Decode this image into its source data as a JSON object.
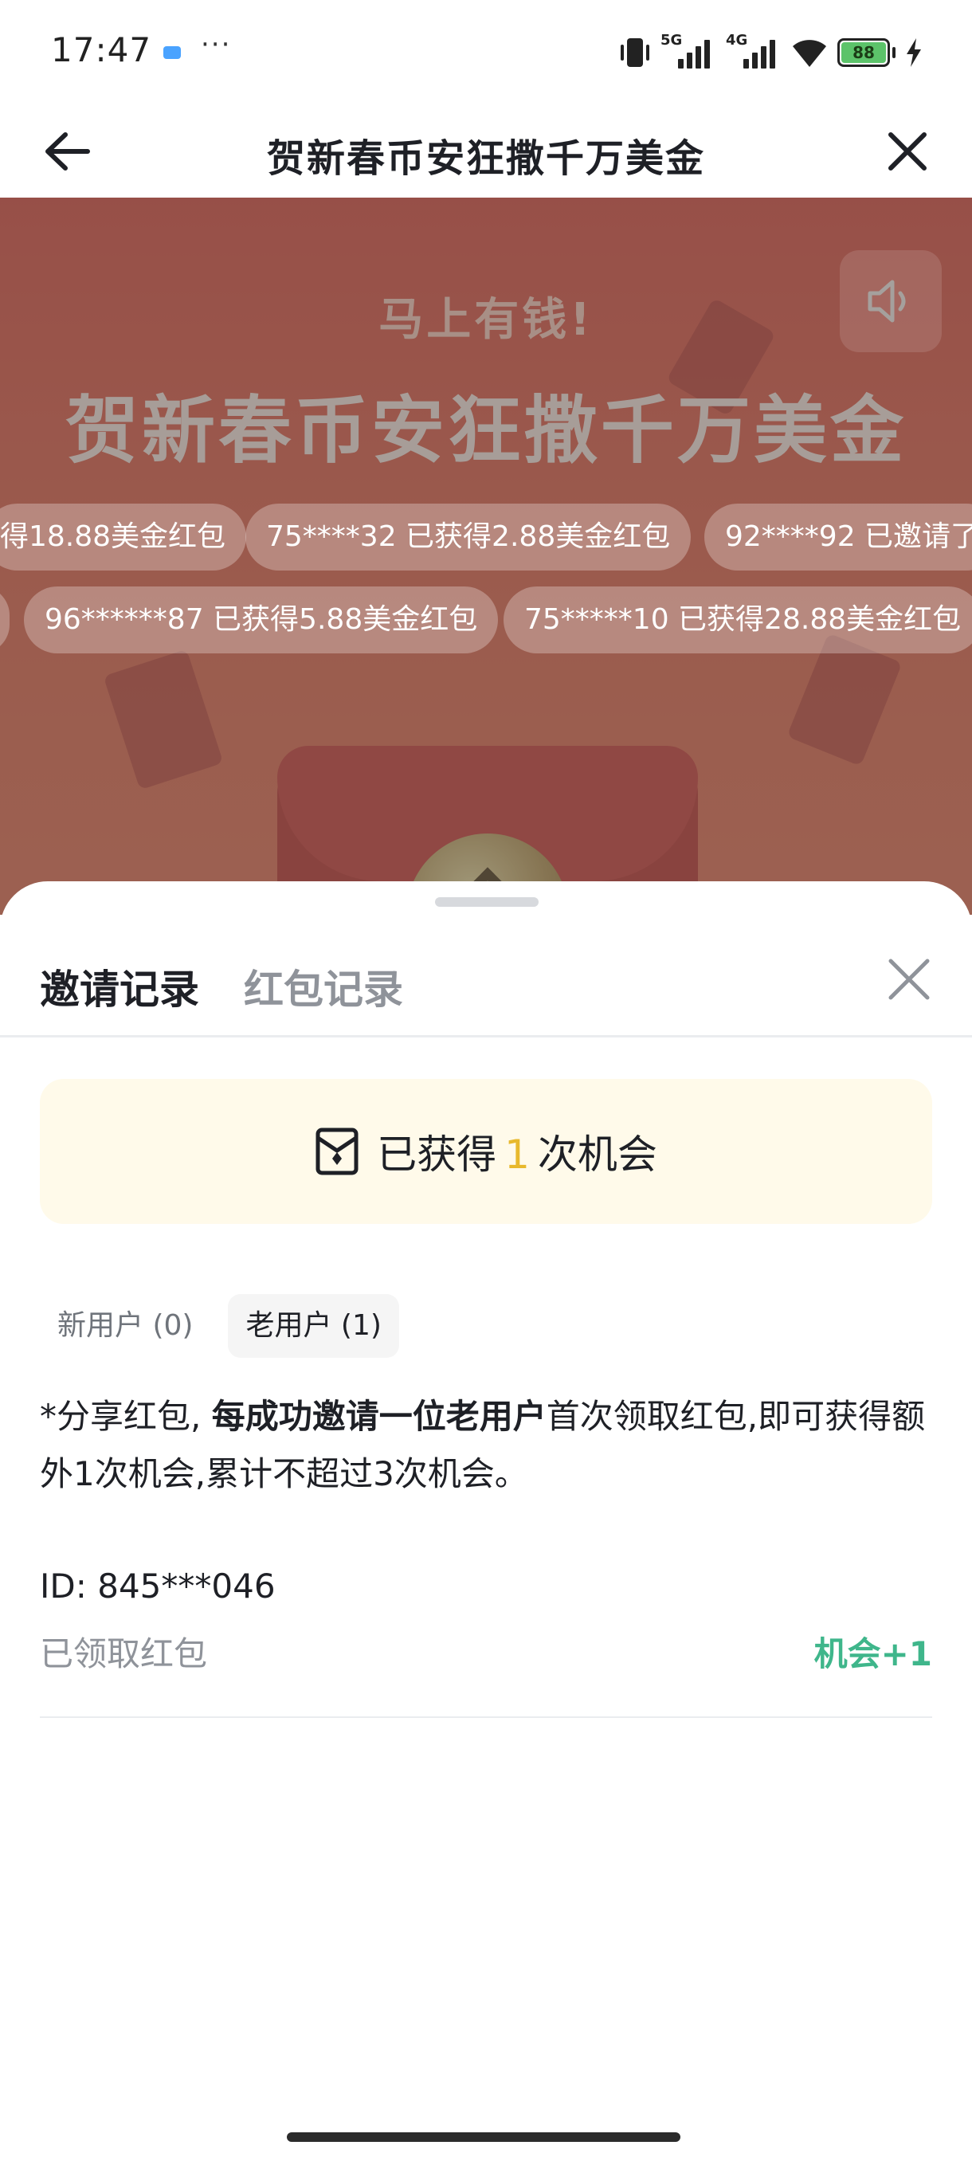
{
  "status_bar": {
    "time": "17:47",
    "more": "···",
    "network_5g": "5G",
    "network_4g": "4G",
    "battery": "88"
  },
  "header": {
    "title": "贺新春币安狂撒千万美金"
  },
  "banner": {
    "subtitle": "马上有钱!",
    "title": "贺新春币安狂撒千万美金",
    "ticker_row1": [
      "得18.88美金红包",
      "75****32 已获得2.88美金红包",
      "92****92 已邀请了"
    ],
    "ticker_row2": [
      "96******87 已获得5.88美金红包",
      "75*****10 已获得28.88美金红包"
    ]
  },
  "sheet": {
    "tabs": [
      {
        "label": "邀请记录",
        "active": true
      },
      {
        "label": "红包记录",
        "active": false
      }
    ],
    "chances": {
      "prefix": "已获得",
      "count": "1",
      "suffix": "次机会"
    },
    "filters": [
      {
        "label": "新用户 (0)",
        "selected": false
      },
      {
        "label": "老用户 (1)",
        "selected": true
      }
    ],
    "description": {
      "part1": "*分享红包,",
      "bold": "每成功邀请一位老用户",
      "part2": "首次领取红包,即可获得额外1次机会,累计不超过3次机会。"
    },
    "records": [
      {
        "id": "ID: 845***046",
        "status": "已领取红包",
        "reward": "机会+1"
      }
    ]
  },
  "colors": {
    "accent_yellow": "#e8b92d",
    "positive_green": "#3fb68b",
    "card_bg": "#fffaea"
  }
}
